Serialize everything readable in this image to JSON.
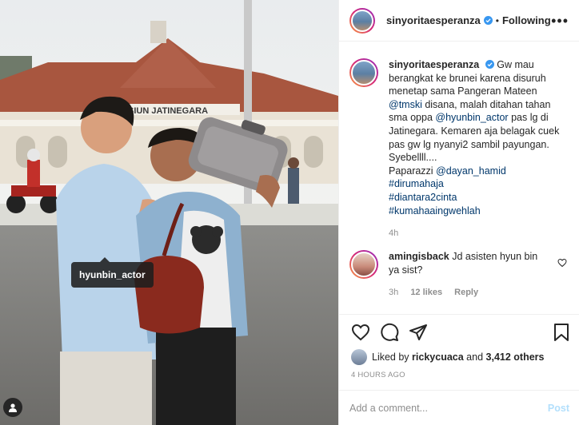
{
  "photo": {
    "tag_label": "hyunbin_actor",
    "sign_text": "SIUN JATINEGARA"
  },
  "header": {
    "username": "sinyoritaesperanza",
    "separator": "•",
    "follow_status": "Following",
    "more_icon": "more-horizontal-icon"
  },
  "caption": {
    "username": "sinyoritaesperanza",
    "text_part1": "Gw mau berangkat ke brunei karena disuruh menetap sama Pangeran Mateen ",
    "mention1": "@tmski",
    "text_part2": " disana, malah ditahan tahan sma oppa ",
    "mention2": "@hyunbin_actor",
    "text_part3": " pas lg di Jatinegara. Kemaren aja belagak cuek pas gw lg nyanyi2 sambil payungan. Syebellll....",
    "paparazzi_label": "Paparazzi ",
    "mention3": "@dayan_hamid",
    "hashtags": [
      "#dirumahaja",
      "#diantara2cinta",
      "#kumahaaingwehlah"
    ],
    "time": "4h"
  },
  "comment": {
    "username": "amingisback",
    "text": " Jd asisten hyun bin ya sist?",
    "time": "3h",
    "likes": "12 likes",
    "reply": "Reply"
  },
  "actions": {
    "liked_by_prefix": "Liked by ",
    "liked_by_user": "rickycuaca",
    "liked_by_and": " and ",
    "liked_by_count": "3,412 others",
    "timestamp": "4 HOURS AGO"
  },
  "add_comment": {
    "placeholder": "Add a comment...",
    "post_label": "Post"
  },
  "colors": {
    "link": "#00376b",
    "verified": "#3897f0",
    "post_disabled": "#b2dffc",
    "muted": "#8e8e8e"
  }
}
